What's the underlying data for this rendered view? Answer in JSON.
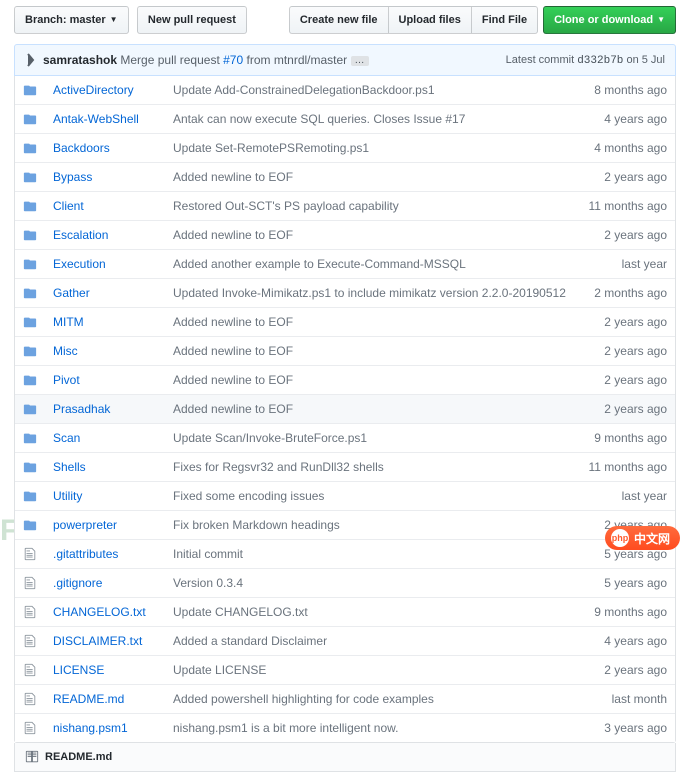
{
  "toolbar": {
    "branch_label": "Branch:",
    "branch_name": "master",
    "new_pr": "New pull request",
    "create_file": "Create new file",
    "upload": "Upload files",
    "find_file": "Find File",
    "clone": "Clone or download"
  },
  "commit": {
    "author": "samratashok",
    "action": "Merge pull request",
    "pr": "#70",
    "from_text": "from mtnrdl/master",
    "latest_label": "Latest commit",
    "sha": "d332b7b",
    "date_text": "on 5 Jul"
  },
  "files": [
    {
      "type": "dir",
      "name": "ActiveDirectory",
      "msg": "Update Add-ConstrainedDelegationBackdoor.ps1",
      "age": "8 months ago"
    },
    {
      "type": "dir",
      "name": "Antak-WebShell",
      "msg": "Antak can now execute SQL queries. Closes Issue #17",
      "age": "4 years ago"
    },
    {
      "type": "dir",
      "name": "Backdoors",
      "msg": "Update Set-RemotePSRemoting.ps1",
      "age": "4 months ago"
    },
    {
      "type": "dir",
      "name": "Bypass",
      "msg": "Added newline to EOF",
      "age": "2 years ago"
    },
    {
      "type": "dir",
      "name": "Client",
      "msg": "Restored Out-SCT's PS payload capability",
      "age": "11 months ago"
    },
    {
      "type": "dir",
      "name": "Escalation",
      "msg": "Added newline to EOF",
      "age": "2 years ago"
    },
    {
      "type": "dir",
      "name": "Execution",
      "msg": "Added another example to Execute-Command-MSSQL",
      "age": "last year"
    },
    {
      "type": "dir",
      "name": "Gather",
      "msg": "Updated Invoke-Mimikatz.ps1 to include mimikatz version 2.2.0-20190512",
      "age": "2 months ago"
    },
    {
      "type": "dir",
      "name": "MITM",
      "msg": "Added newline to EOF",
      "age": "2 years ago"
    },
    {
      "type": "dir",
      "name": "Misc",
      "msg": "Added newline to EOF",
      "age": "2 years ago"
    },
    {
      "type": "dir",
      "name": "Pivot",
      "msg": "Added newline to EOF",
      "age": "2 years ago"
    },
    {
      "type": "dir",
      "name": "Prasadhak",
      "msg": "Added newline to EOF",
      "age": "2 years ago",
      "alt": true
    },
    {
      "type": "dir",
      "name": "Scan",
      "msg": "Update Scan/Invoke-BruteForce.ps1",
      "age": "9 months ago"
    },
    {
      "type": "dir",
      "name": "Shells",
      "msg": "Fixes for Regsvr32 and RunDll32 shells",
      "age": "11 months ago"
    },
    {
      "type": "dir",
      "name": "Utility",
      "msg": "Fixed some encoding issues",
      "age": "last year"
    },
    {
      "type": "dir",
      "name": "powerpreter",
      "msg": "Fix broken Markdown headings",
      "age": "2 years ago"
    },
    {
      "type": "file",
      "name": ".gitattributes",
      "msg": "Initial commit",
      "age": "5 years ago"
    },
    {
      "type": "file",
      "name": ".gitignore",
      "msg": "Version 0.3.4",
      "age": "5 years ago"
    },
    {
      "type": "file",
      "name": "CHANGELOG.txt",
      "msg": "Update CHANGELOG.txt",
      "age": "9 months ago"
    },
    {
      "type": "file",
      "name": "DISCLAIMER.txt",
      "msg": "Added a standard Disclaimer",
      "age": "4 years ago"
    },
    {
      "type": "file",
      "name": "LICENSE",
      "msg": "Update LICENSE",
      "age": "2 years ago"
    },
    {
      "type": "file",
      "name": "README.md",
      "msg": "Added powershell highlighting for code examples",
      "age": "last month"
    },
    {
      "type": "file",
      "name": "nishang.psm1",
      "msg": "nishang.psm1 is a bit more intelligent now.",
      "age": "3 years ago"
    }
  ],
  "readme": {
    "filename": "README.md"
  },
  "watermarks": {
    "left": "FREEBUF",
    "right": "中文网"
  }
}
